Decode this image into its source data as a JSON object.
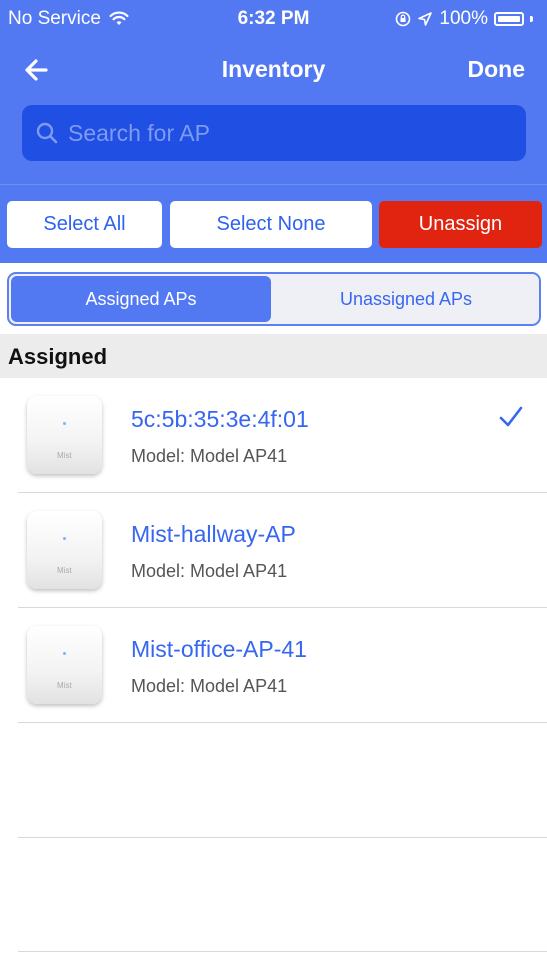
{
  "status_bar": {
    "carrier": "No Service",
    "time": "6:32 PM",
    "battery": "100%"
  },
  "nav": {
    "title": "Inventory",
    "done_label": "Done"
  },
  "search": {
    "placeholder": "Search for AP",
    "value": ""
  },
  "actions": {
    "select_all": "Select All",
    "select_none": "Select None",
    "unassign": "Unassign"
  },
  "segments": {
    "assigned": "Assigned APs",
    "unassigned": "Unassigned APs",
    "active": "assigned"
  },
  "section": {
    "title": "Assigned"
  },
  "aps": [
    {
      "name": "5c:5b:35:3e:4f:01",
      "model": "Model: Model AP41",
      "selected": true
    },
    {
      "name": "Mist-hallway-AP",
      "model": "Model: Model AP41",
      "selected": false
    },
    {
      "name": "Mist-office-AP-41",
      "model": "Model: Model AP41",
      "selected": false
    }
  ],
  "colors": {
    "header_bg": "#5379f2",
    "search_bg": "#1f50e3",
    "link_blue": "#3766ef",
    "danger": "#e0240f"
  },
  "icons": [
    "wifi-icon",
    "orientation-lock-icon",
    "location-arrow-icon",
    "battery-icon",
    "back-arrow-icon",
    "search-icon",
    "checkmark-icon"
  ]
}
